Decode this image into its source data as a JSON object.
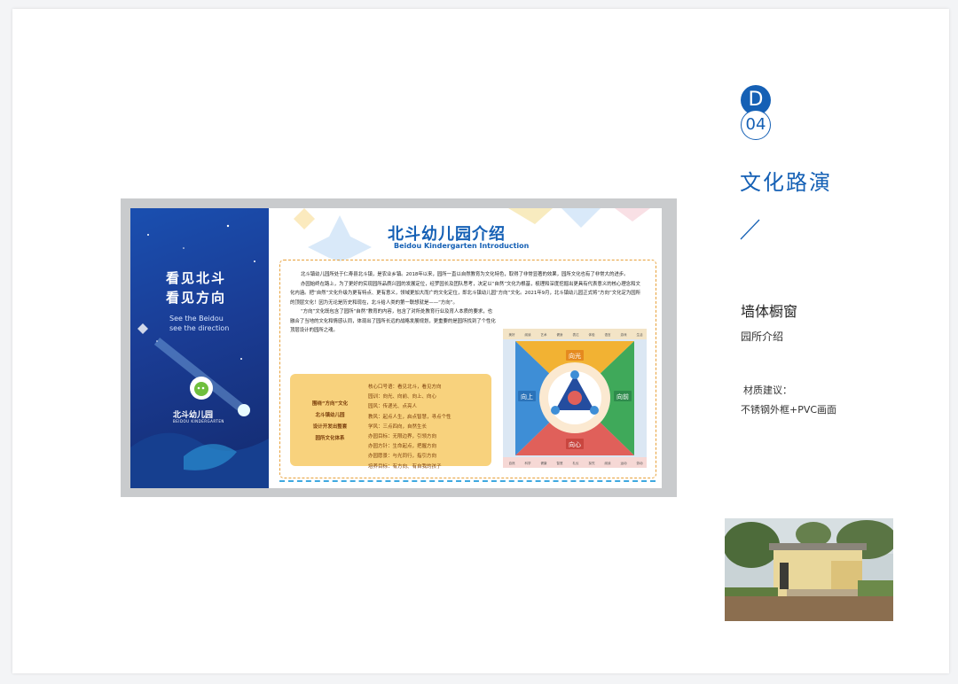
{
  "section": {
    "letter": "D",
    "number": "04",
    "title": "文化路演"
  },
  "item": {
    "title": "墙体橱窗",
    "subtitle": "园所介绍"
  },
  "material": {
    "label": "材质建议：",
    "value": "不锈钢外框+PVC画面"
  },
  "board": {
    "left_title_line1": "看见北斗",
    "left_title_line2": "看见方向",
    "left_en_line1": "See the Beidou",
    "left_en_line2": "see the direction",
    "logo_name": "北斗幼儿园",
    "logo_en": "BEIDOU KINDERGARTEN",
    "title": "北斗幼儿园介绍",
    "title_en": "Beidou Kindergarten Introduction",
    "paragraphs": [
      "北斗镇幼儿园所处于仁寿县北斗镇，是农业乡镇。2018年以来，园所一直以自然教育为文化特色，取得了非常显著的效果，园所文化也有了非常大的进步。",
      "办园始终在路上，为了更好的实现园所品质兴园的发展定位，经罗园长及团队思考，决定以“自然”文化为根基，梳理和深度挖掘出更具有代表意义的核心理念和文化内涵。把“自然”文化升级为更有特点、更有意义，领域更加大而广的文化定位，即北斗镇幼儿园“方向”文化。2021年9月，北斗镇幼儿园正式将“方向”文化定为园所的顶层文化！因为无论是历史和现在，北斗给人类的第一联想就是——“方向”。",
      "“方向”文化既包含了园所“自然”教育的内容，包含了对所处教育行业及育人本质的要求，也融合了当地的文化和情感认同，体现出了园所长远的战略发展规划，更重要的是园所找到了个性化顶层设计的园所之魂。"
    ],
    "yellow_left": [
      "围绕“方向”文化",
      "北斗镇幼儿园",
      "设计开发出整套",
      "园所文化体系"
    ],
    "yellow_right": [
      "核心口号语：看见北斗，看见方向",
      "园训：向光、向前、向上、向心",
      "园风：传递光、点亮人",
      "教风：起点人生，启点智慧，寻点个性",
      "学风：三点四向，自然生长",
      "办园目标：无限边界，引领方向",
      "办园方针：生命起点，把握方向",
      "办园愿景：与光同行，指引方向",
      "培养目标：有方向、有自我的孩子"
    ],
    "diagram": {
      "directions": [
        "向光",
        "向前",
        "向心",
        "向上"
      ],
      "top_row": [
        "美好",
        "阅读",
        "艺术",
        "健身",
        "表达",
        "体验",
        "语言",
        "游戏",
        "生活"
      ],
      "bottom_row": [
        "自然",
        "科学",
        "健康",
        "智慧",
        "礼仪",
        "探究",
        "阅读",
        "运动",
        "劳动"
      ]
    }
  }
}
